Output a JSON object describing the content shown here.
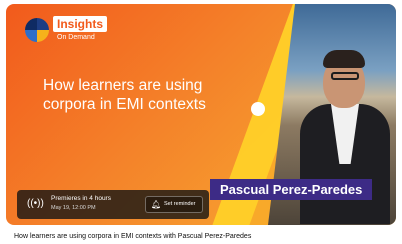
{
  "brand": {
    "name": "Insights",
    "subtitle": "On Demand"
  },
  "thumbnail": {
    "headline_line1": "How learners are using",
    "headline_line2": "corpora in EMI contexts",
    "speaker_name": "Pascual Perez-Paredes"
  },
  "premiere": {
    "icon": "broadcast-icon",
    "title": "Premieres in 4 hours",
    "date": "May 19, 12:00 PM",
    "reminder_icon": "bell-icon",
    "reminder_label": "Set reminder"
  },
  "video": {
    "title": "How learners are using corpora in EMI contexts with Pascual Perez-Paredes"
  },
  "colors": {
    "accent_orange": "#f25a1c",
    "accent_yellow": "#ffd028",
    "name_tag_purple": "#3d2b86"
  }
}
